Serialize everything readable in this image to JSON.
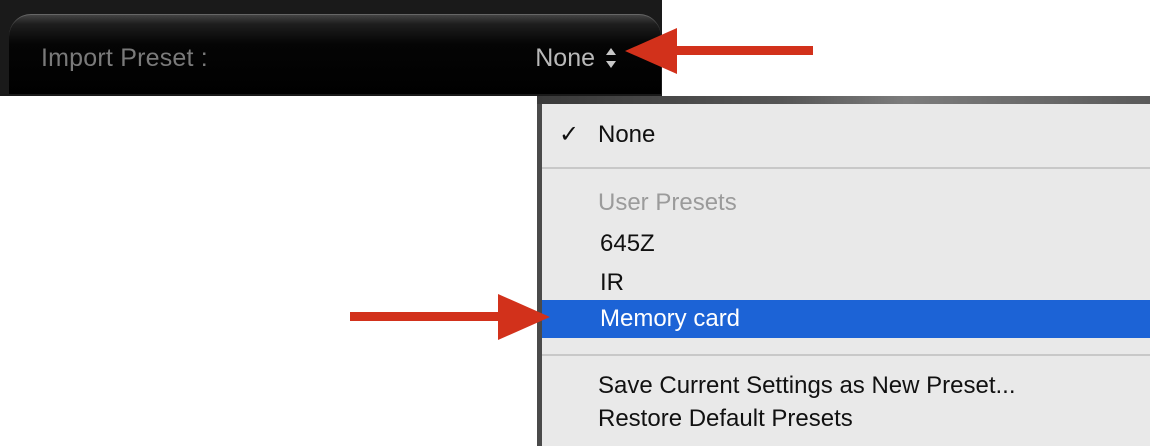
{
  "import_preset": {
    "label": "Import Preset :",
    "value": "None"
  },
  "menu": {
    "checked_item": "None",
    "check_mark": "✓",
    "section_header": "User Presets",
    "presets": [
      "645Z",
      "IR",
      "Memory card"
    ],
    "highlighted_preset": "Memory card",
    "actions": [
      "Save Current Settings as New Preset...",
      "Restore Default Presets"
    ]
  },
  "colors": {
    "highlight": "#1c63d6",
    "arrow": "#d2311b"
  }
}
